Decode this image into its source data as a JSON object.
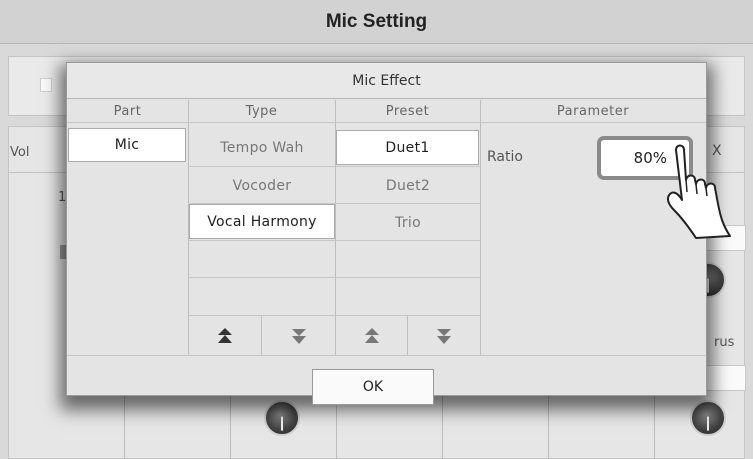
{
  "screen": {
    "title": "Mic Setting",
    "bg_labels": {
      "vol": "Vol",
      "num": "1",
      "x": "X",
      "rus": "rus"
    }
  },
  "dialog": {
    "title": "Mic Effect",
    "columns": {
      "part": "Part",
      "type": "Type",
      "preset": "Preset",
      "parameter": "Parameter"
    },
    "part_items": [
      "Mic"
    ],
    "type_items": [
      "Tempo Wah",
      "Vocoder",
      "Vocal Harmony",
      "",
      ""
    ],
    "preset_items": [
      "Duet1",
      "Duet2",
      "Trio",
      "",
      ""
    ],
    "parameter": {
      "label": "Ratio",
      "value": "80%"
    },
    "ok_label": "OK",
    "icons": {
      "type_up": "double-up-arrow-icon",
      "type_down": "double-down-arrow-icon",
      "preset_up": "double-up-arrow-icon",
      "preset_down": "double-down-arrow-icon",
      "hand": "pointing-hand-icon"
    }
  },
  "colors": {
    "selected_cell": "#ffffff",
    "dialog_bg": "#e4e4e4",
    "highlight_border": "#8a8a8a"
  }
}
